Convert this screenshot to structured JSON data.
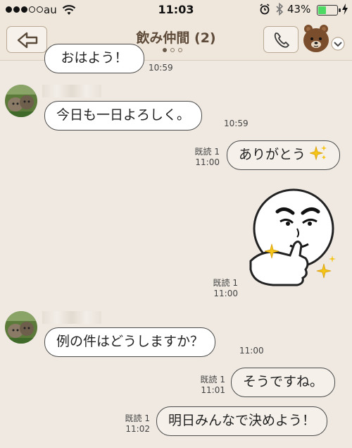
{
  "status_bar": {
    "carrier": "au",
    "time": "11:03",
    "battery": "43%",
    "battery_level": 0.43
  },
  "header": {
    "title": "飲み仲間 (2)",
    "page_count": 3,
    "active_page": 1
  },
  "messages": {
    "m0": {
      "text": "おはよう！",
      "time": "10:59"
    },
    "m1": {
      "text": "今日も一日よろしく。",
      "time": "10:59"
    },
    "m2": {
      "text": "ありがとう",
      "read": "既読 1",
      "time": "11:00"
    },
    "m3": {
      "read": "既読 1",
      "time": "11:00"
    },
    "m4": {
      "text": "例の件はどうしますか？",
      "time": "11:00"
    },
    "m5": {
      "text": "そうですね。",
      "read": "既読 1",
      "time": "11:01"
    },
    "m6": {
      "text": "明日みんなで決めよう！",
      "read": "既読 1",
      "time": "11:02"
    }
  },
  "colors": {
    "background": "#efe9e1",
    "header": "#efe7dc",
    "title": "#5e4a38",
    "bubble_border": "#4b4b4b"
  }
}
